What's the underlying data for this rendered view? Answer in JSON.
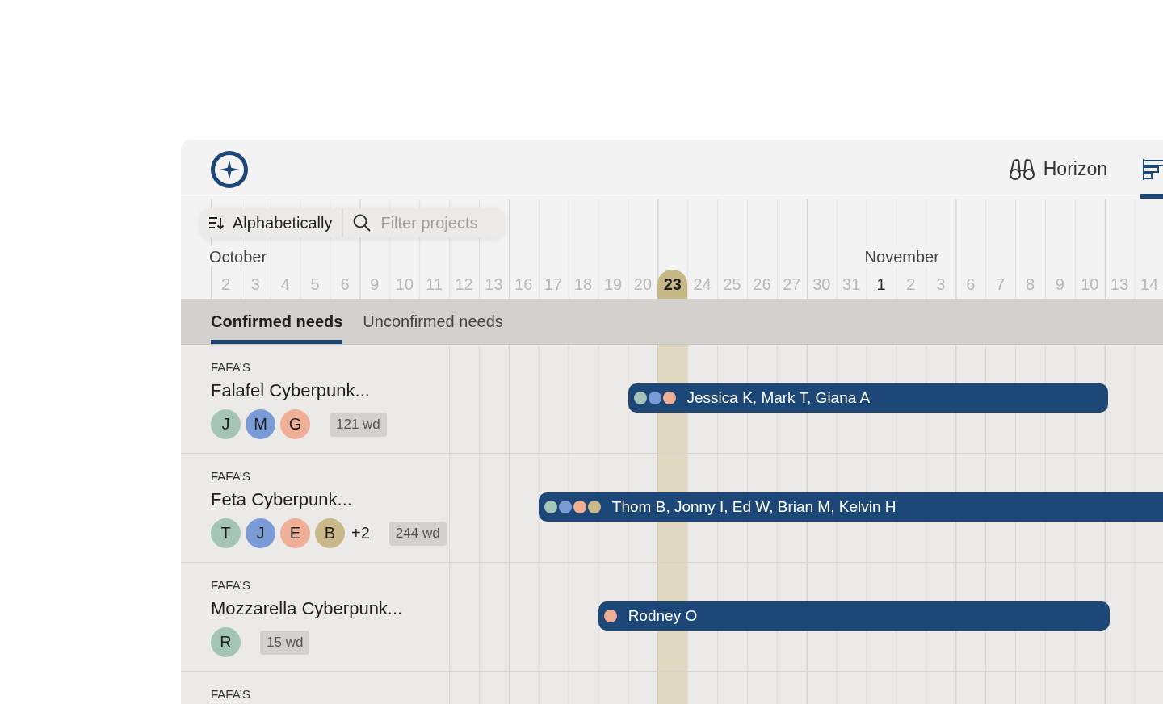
{
  "header": {
    "nav": [
      {
        "label": "Horizon",
        "selected": false
      },
      {
        "selected": true
      }
    ]
  },
  "toolbar": {
    "sort_label": "Alphabetically",
    "search_placeholder": "Filter projects"
  },
  "days": [
    {
      "label": "2",
      "month": "October",
      "today": false,
      "month_start": false
    },
    {
      "label": "3",
      "today": false,
      "month_start": false
    },
    {
      "label": "4",
      "today": false,
      "month_start": false
    },
    {
      "label": "5",
      "today": false,
      "month_start": false
    },
    {
      "label": "6",
      "today": false,
      "month_start": false
    },
    {
      "label": "9",
      "today": false,
      "month_start": false
    },
    {
      "label": "10",
      "today": false,
      "month_start": false
    },
    {
      "label": "11",
      "today": false,
      "month_start": false
    },
    {
      "label": "12",
      "today": false,
      "month_start": false
    },
    {
      "label": "13",
      "today": false,
      "month_start": false
    },
    {
      "label": "16",
      "today": false,
      "month_start": false
    },
    {
      "label": "17",
      "today": false,
      "month_start": false
    },
    {
      "label": "18",
      "today": false,
      "month_start": false
    },
    {
      "label": "19",
      "today": false,
      "month_start": false
    },
    {
      "label": "20",
      "today": false,
      "month_start": false
    },
    {
      "label": "23",
      "today": true,
      "month_start": false
    },
    {
      "label": "24",
      "today": false,
      "month_start": false
    },
    {
      "label": "25",
      "today": false,
      "month_start": false
    },
    {
      "label": "26",
      "today": false,
      "month_start": false
    },
    {
      "label": "27",
      "today": false,
      "month_start": false
    },
    {
      "label": "30",
      "today": false,
      "month_start": false
    },
    {
      "label": "31",
      "today": false,
      "month_start": false
    },
    {
      "label": "1",
      "month": "November",
      "today": false,
      "month_start": true
    },
    {
      "label": "2",
      "today": false,
      "month_start": false
    },
    {
      "label": "3",
      "today": false,
      "month_start": false
    },
    {
      "label": "6",
      "today": false,
      "month_start": false
    },
    {
      "label": "7",
      "today": false,
      "month_start": false
    },
    {
      "label": "8",
      "today": false,
      "month_start": false
    },
    {
      "label": "9",
      "today": false,
      "month_start": false
    },
    {
      "label": "10",
      "today": false,
      "month_start": false
    },
    {
      "label": "13",
      "today": false,
      "month_start": false
    },
    {
      "label": "14",
      "today": false,
      "month_start": false
    }
  ],
  "tabs": [
    {
      "label": "Confirmed needs",
      "selected": true
    },
    {
      "label": "Unconfirmed needs",
      "selected": false
    }
  ],
  "projects": [
    {
      "client": "FAFA’S",
      "title": "Falafel Cyberpunk...",
      "avatars": [
        {
          "initial": "J",
          "color": "#a4c4b8"
        },
        {
          "initial": "M",
          "color": "#7b9bd6"
        },
        {
          "initial": "G",
          "color": "#efae96"
        }
      ],
      "duration": "121 wd",
      "bar": {
        "dots": [
          {
            "color": "#a4c4b8"
          },
          {
            "color": "#7b9bd6"
          },
          {
            "color": "#efae96"
          }
        ],
        "label": "Jessica K, Mark T, Giana A"
      }
    },
    {
      "client": "FAFA’S",
      "title": "Feta Cyberpunk...",
      "avatars": [
        {
          "initial": "T",
          "color": "#a4c4b8"
        },
        {
          "initial": "J",
          "color": "#7b9bd6"
        },
        {
          "initial": "E",
          "color": "#efae96"
        },
        {
          "initial": "B",
          "color": "#c9b98a"
        }
      ],
      "more": "+2",
      "duration": "244 wd",
      "bar": {
        "dots": [
          {
            "color": "#a4c4b8"
          },
          {
            "color": "#7b9bd6"
          },
          {
            "color": "#efae96"
          },
          {
            "color": "#c9b98a"
          }
        ],
        "label": "Thom B, Jonny I, Ed W, Brian M, Kelvin H"
      }
    },
    {
      "client": "FAFA’S",
      "title": "Mozzarella Cyberpunk...",
      "avatars": [
        {
          "initial": "R",
          "color": "#a4c4b8"
        }
      ],
      "duration": "15 wd",
      "bar": {
        "dots": [
          {
            "color": "#efae96"
          }
        ],
        "label": "Rodney O"
      }
    },
    {
      "client": "FAFA’S"
    }
  ]
}
